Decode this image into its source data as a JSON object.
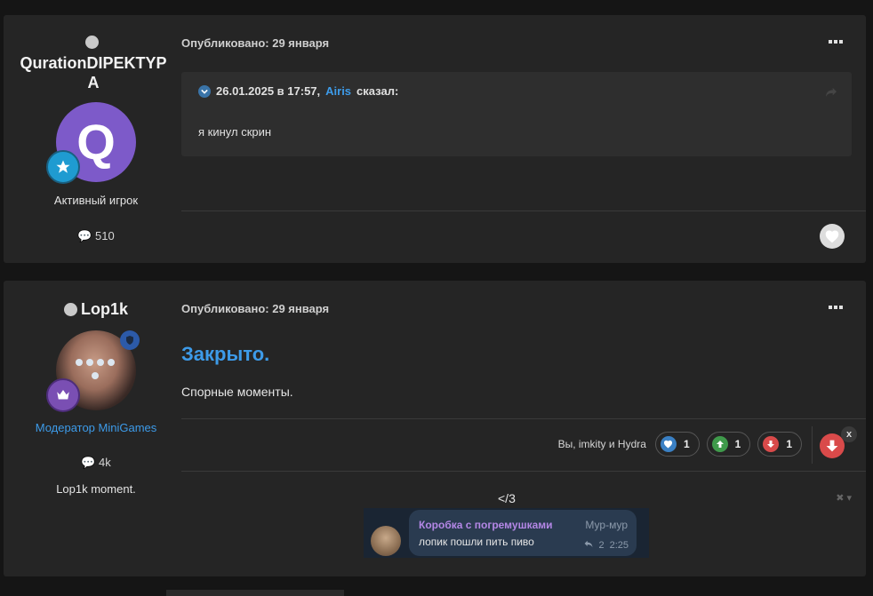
{
  "post1": {
    "author": {
      "name": "QurationDIPEKTYPA",
      "avatar_letter": "Q",
      "role": "Активный игрок",
      "posts": "510"
    },
    "published": "Опубликовано: 29 января",
    "quote": {
      "date": "26.01.2025 в 17:57,",
      "author": "Airis",
      "said": "сказал:",
      "text": "я кинул скрин"
    }
  },
  "post2": {
    "author": {
      "name": "Lop1k",
      "role": "Модератор MiniGames",
      "posts": "4k",
      "tagline": "Lop1k moment."
    },
    "published": "Опубликовано: 29 января",
    "title": "Закрыто.",
    "text": "Спорные моменты.",
    "reactions": {
      "who": "Вы, imkity и Hydra",
      "items": [
        {
          "icon": "heart-icon",
          "count": "1",
          "color": "#3a80c4"
        },
        {
          "icon": "arrow-up-icon",
          "count": "1",
          "color": "#3f9a4b"
        },
        {
          "icon": "arrow-down-icon",
          "count": "1",
          "color": "#d94a4a"
        }
      ],
      "dismiss": "x"
    },
    "signature": {
      "text": "</3",
      "close_glyph": "✖ ▾",
      "chat": {
        "name": "Коробка с погремушками",
        "tag": "Мур-мур",
        "message": "лопик пошли пить пиво",
        "replies": "2",
        "time": "2:25"
      }
    }
  }
}
